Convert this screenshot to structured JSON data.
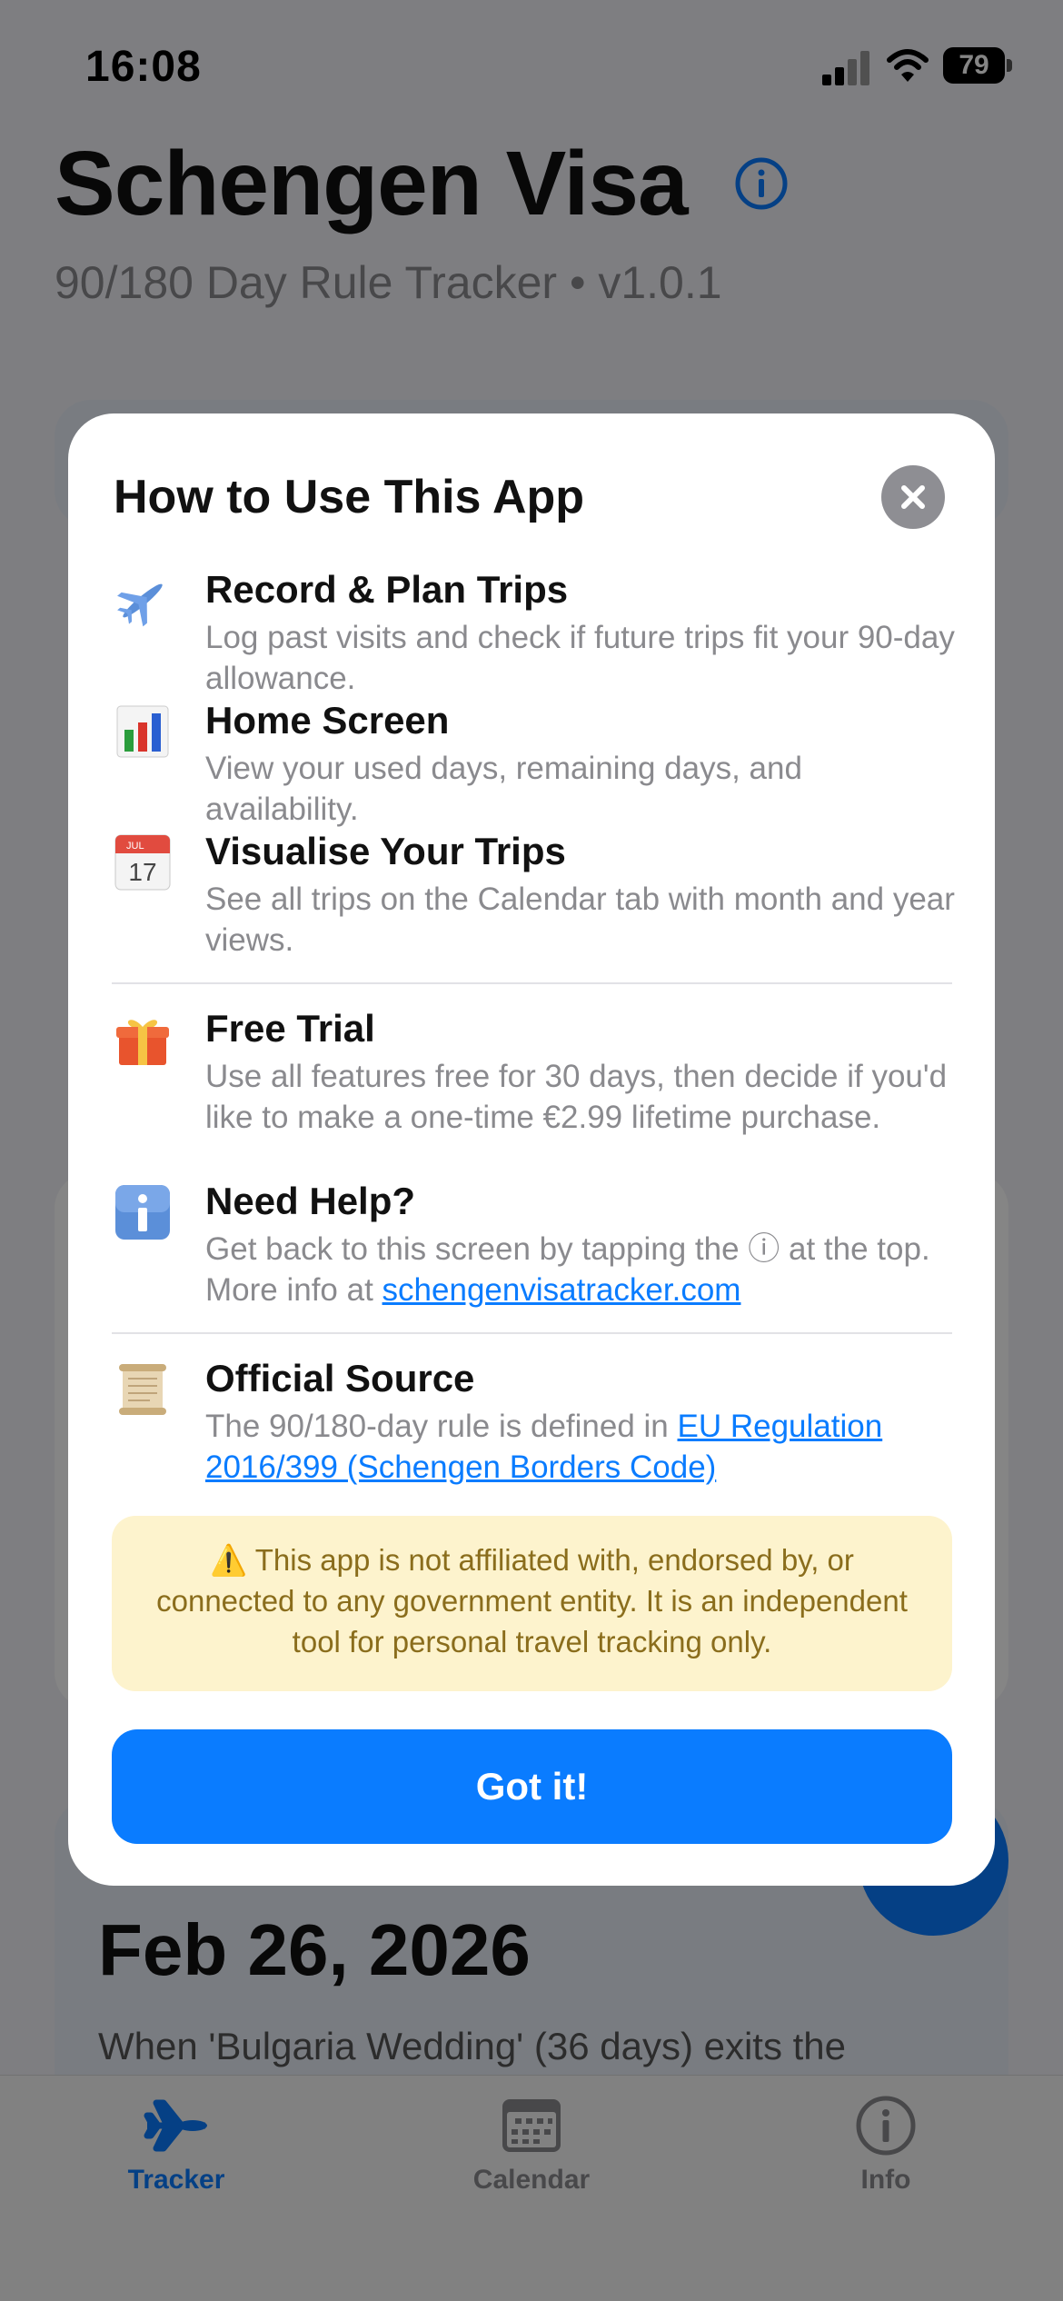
{
  "status_bar": {
    "time": "16:08",
    "battery": "79"
  },
  "header": {
    "title": "Schengen Visa",
    "subtitle": "90/180 Day Rule Tracker • v1.0.1"
  },
  "background": {
    "date": "Feb 26, 2026",
    "date_description": "When 'Bulgaria Wedding' (36 days) exits the"
  },
  "modal": {
    "title": "How to Use This App",
    "items": [
      {
        "icon": "airplane-icon",
        "title": "Record & Plan Trips",
        "desc": "Log past visits and check if future trips fit your 90-day allowance."
      },
      {
        "icon": "bar-chart-icon",
        "title": "Home Screen",
        "desc": "View your used days, remaining days, and availability."
      },
      {
        "icon": "calendar-icon",
        "title": "Visualise Your Trips",
        "desc": "See all trips on the Calendar tab with month and year views.",
        "calendar_month": "JUL",
        "calendar_day": "17"
      },
      {
        "icon": "gift-icon",
        "title": "Free Trial",
        "desc": "Use all features free for 30 days, then decide if you'd like to make a one-time €2.99 lifetime purchase."
      },
      {
        "icon": "info-icon",
        "title": "Need Help?",
        "desc_before": "Get back to this screen by tapping the ⓘ at the top. More info at ",
        "link": "schengenvisatracker.com"
      },
      {
        "icon": "scroll-icon",
        "title": "Official Source",
        "desc_before": "The 90/180-day rule is defined in ",
        "link": "EU Regulation 2016/399 (Schengen Borders Code)"
      }
    ],
    "disclaimer": "⚠️ This app is not affiliated with, endorsed by, or connected to any government entity. It is an independent tool for personal travel tracking only.",
    "button": "Got it!"
  },
  "tabs": [
    {
      "label": "Tracker",
      "icon": "airplane-icon",
      "active": true
    },
    {
      "label": "Calendar",
      "icon": "calendar-icon",
      "active": false
    },
    {
      "label": "Info",
      "icon": "info-icon",
      "active": false
    }
  ],
  "colors": {
    "accent": "#0a7cff",
    "disclaimer_bg": "#fdf3cd",
    "disclaimer_text": "#8a6d1c"
  }
}
